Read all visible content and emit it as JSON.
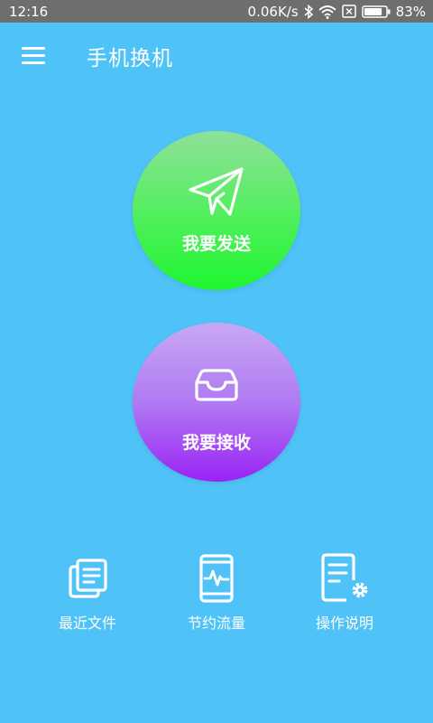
{
  "status_bar": {
    "time": "12:16",
    "speed": "0.06K/s",
    "battery": "83%",
    "battery_level": 0.83
  },
  "app_bar": {
    "title": "手机换机",
    "menu_icon": "hamburger-menu-icon"
  },
  "actions": {
    "send": {
      "label": "我要发送",
      "icon": "paper-plane-icon",
      "color_top": "#8fe19a",
      "color_bottom": "#1ff52f"
    },
    "receive": {
      "label": "我要接收",
      "icon": "inbox-tray-icon",
      "color_top": "#c7a8f4",
      "color_bottom": "#9a23f5"
    }
  },
  "toolbar": {
    "items": [
      {
        "label": "最近文件",
        "icon": "recent-files-icon"
      },
      {
        "label": "节约流量",
        "icon": "phone-traffic-icon"
      },
      {
        "label": "操作说明",
        "icon": "document-settings-icon"
      }
    ]
  },
  "colors": {
    "background": "#4fc3f7",
    "status_bar": "#6e6e6e"
  }
}
